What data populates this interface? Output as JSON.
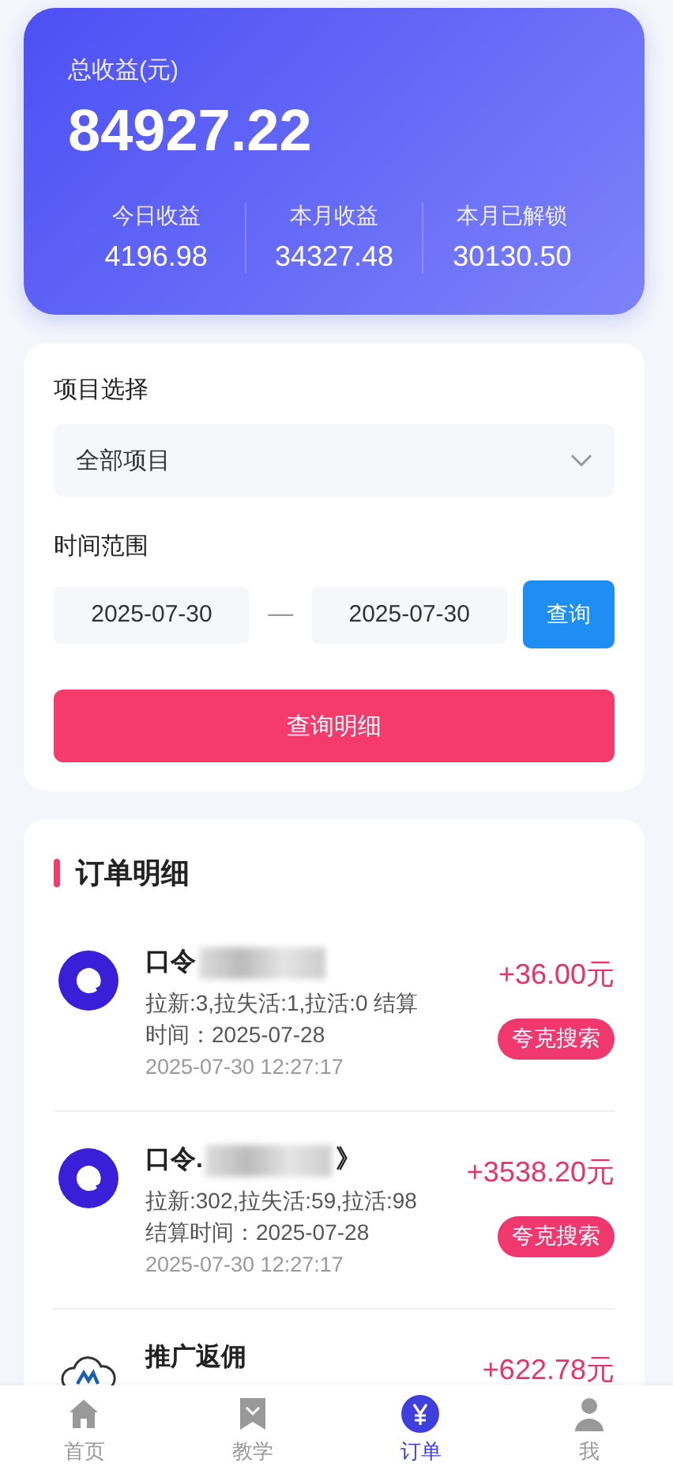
{
  "summary": {
    "label": "总收益(元)",
    "total": "84927.22",
    "stats": [
      {
        "label": "今日收益",
        "value": "4196.98"
      },
      {
        "label": "本月收益",
        "value": "34327.48"
      },
      {
        "label": "本月已解锁",
        "value": "30130.50"
      }
    ]
  },
  "filter": {
    "project_label": "项目选择",
    "project_value": "全部项目",
    "range_label": "时间范围",
    "start_date": "2025-07-30",
    "separator": "—",
    "end_date": "2025-07-30",
    "query_button": "查询",
    "detail_button": "查询明细"
  },
  "orders": {
    "title": "订单明细",
    "items": [
      {
        "kind": "ring",
        "title": "口令",
        "redacted": true,
        "detail": "拉新:3,拉失活:1,拉活:0 结算时间：2025-07-28",
        "time": "2025-07-30 12:27:17",
        "amount": "+36.00元",
        "tag": "夸克搜索"
      },
      {
        "kind": "ring",
        "title": "口令.",
        "redacted": true,
        "title_suffix": "》",
        "detail": "拉新:302,拉失活:59,拉活:98 结算时间：2025-07-28",
        "time": "2025-07-30 12:27:17",
        "amount": "+3538.20元",
        "tag": "夸克搜索"
      },
      {
        "kind": "cloud",
        "title": "推广返佣",
        "redacted": false,
        "amount": "+622.78元"
      }
    ]
  },
  "nav": [
    {
      "kind": "home",
      "label": "首页",
      "selected": false
    },
    {
      "kind": "book",
      "label": "教学",
      "selected": false
    },
    {
      "kind": "yen",
      "label": "订单",
      "selected": true
    },
    {
      "kind": "user",
      "label": "我",
      "selected": false
    }
  ]
}
